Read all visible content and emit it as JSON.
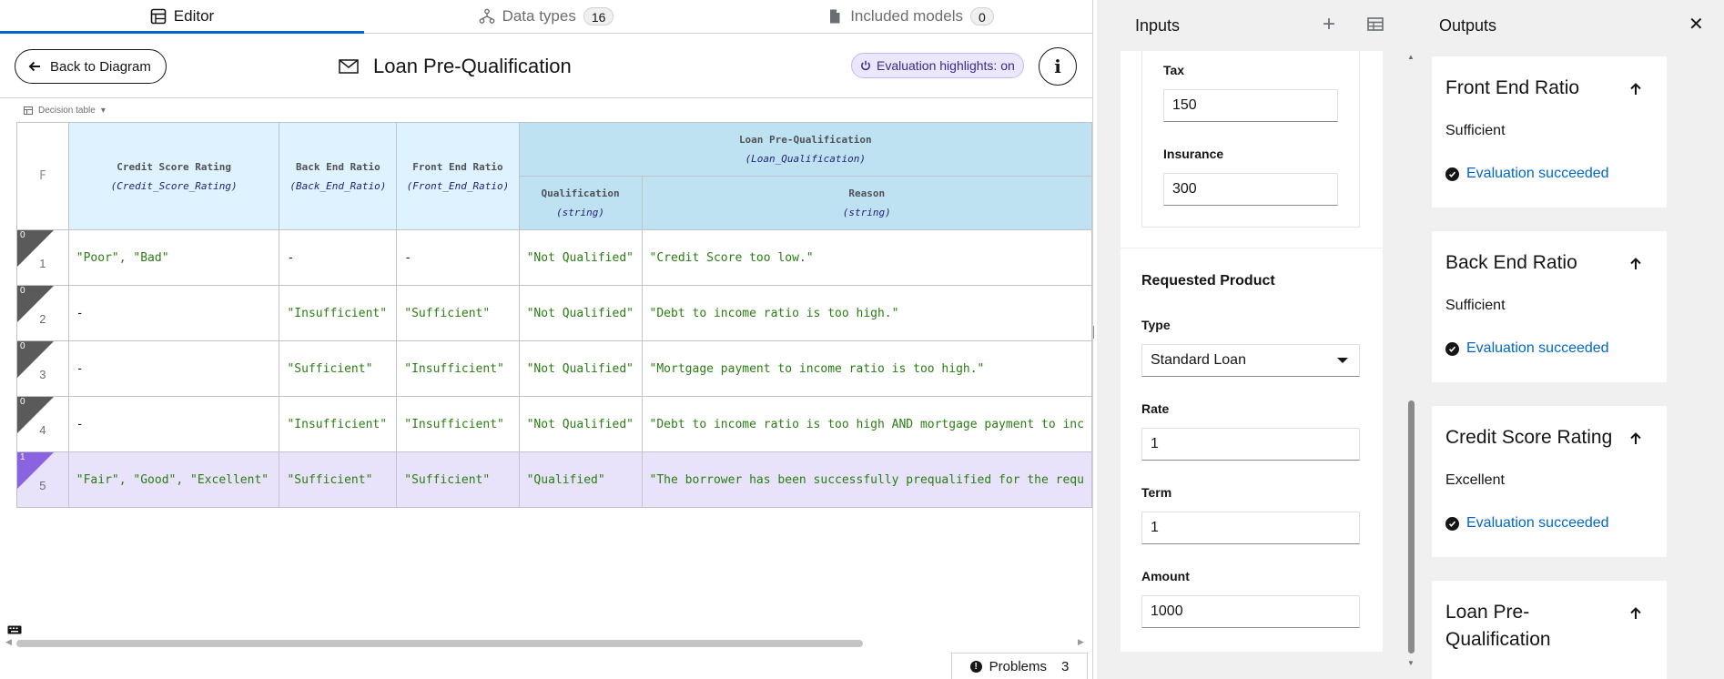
{
  "tabs": [
    {
      "label": "Editor",
      "icon": "table-icon"
    },
    {
      "label": "Data types",
      "count": "16",
      "icon": "hierarchy-icon"
    },
    {
      "label": "Included models",
      "count": "0",
      "icon": "file-icon"
    }
  ],
  "toolbar": {
    "back_label": "Back to Diagram",
    "title": "Loan Pre-Qualification",
    "eval_highlights": "Evaluation highlights: on"
  },
  "decision_table": {
    "label": "Decision table",
    "hit_policy": "F",
    "inputs": [
      {
        "name": "Credit Score Rating",
        "type": "(Credit_Score_Rating)"
      },
      {
        "name": "Back End Ratio",
        "type": "(Back_End_Ratio)"
      },
      {
        "name": "Front End Ratio",
        "type": "(Front_End_Ratio)"
      }
    ],
    "output": {
      "name": "Loan Pre-Qualification",
      "type": "(Loan_Qualification)"
    },
    "output_columns": [
      {
        "name": "Qualification",
        "type": "(string)"
      },
      {
        "name": "Reason",
        "type": "(string)"
      }
    ],
    "rows": [
      {
        "hits": "0",
        "num": "1",
        "cells": [
          "\"Poor\", \"Bad\"",
          "-",
          "-",
          "\"Not Qualified\"",
          "\"Credit Score too low.\""
        ]
      },
      {
        "hits": "0",
        "num": "2",
        "cells": [
          "-",
          "\"Insufficient\"",
          "\"Sufficient\"",
          "\"Not Qualified\"",
          "\"Debt to income ratio is too high.\""
        ]
      },
      {
        "hits": "0",
        "num": "3",
        "cells": [
          "-",
          "\"Sufficient\"",
          "\"Insufficient\"",
          "\"Not Qualified\"",
          "\"Mortgage payment to income ratio is too high.\""
        ]
      },
      {
        "hits": "0",
        "num": "4",
        "cells": [
          "-",
          "\"Insufficient\"",
          "\"Insufficient\"",
          "\"Not Qualified\"",
          "\"Debt to income ratio is too high AND mortgage payment to inc"
        ]
      },
      {
        "hits": "1",
        "num": "5",
        "cells": [
          "\"Fair\", \"Good\", \"Excellent\"",
          "\"Sufficient\"",
          "\"Sufficient\"",
          "\"Qualified\"",
          "\"The borrower has been successfully prequalified for the requ"
        ]
      }
    ]
  },
  "problems": {
    "label": "Problems",
    "count": "3"
  },
  "inputs_panel": {
    "title": "Inputs",
    "tax": {
      "label": "Tax",
      "value": "150"
    },
    "insurance": {
      "label": "Insurance",
      "value": "300"
    },
    "requested_product": {
      "title": "Requested Product",
      "type": {
        "label": "Type",
        "value": "Standard Loan"
      },
      "rate": {
        "label": "Rate",
        "value": "1"
      },
      "term": {
        "label": "Term",
        "value": "1"
      },
      "amount": {
        "label": "Amount",
        "value": "1000"
      }
    }
  },
  "outputs_panel": {
    "title": "Outputs",
    "cards": [
      {
        "title": "Front End Ratio",
        "value": "Sufficient",
        "status": "Evaluation succeeded"
      },
      {
        "title": "Back End Ratio",
        "value": "Sufficient",
        "status": "Evaluation succeeded"
      },
      {
        "title": "Credit Score Rating",
        "value": "Excellent",
        "status": "Evaluation succeeded"
      },
      {
        "title": "Loan Pre-Qualification"
      }
    ]
  },
  "colors": {
    "accent": "#0066cc",
    "selected_row": "#e8e2fb",
    "input_header": "#def3ff",
    "output_header": "#bfe2f2",
    "value_text": "#2a7d12"
  }
}
